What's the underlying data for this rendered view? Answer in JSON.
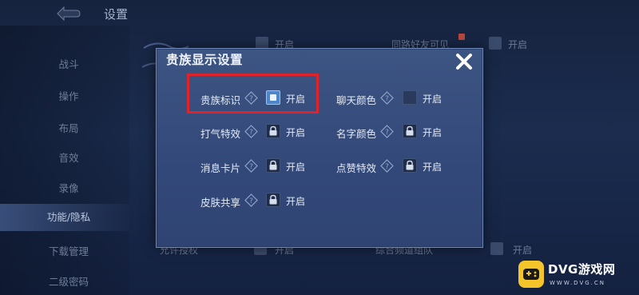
{
  "background": {
    "title": "设置",
    "sidebar": [
      "战斗",
      "操作",
      "布局",
      "音效",
      "录像",
      "功能/隐私",
      "下载管理",
      "二级密码"
    ],
    "active_sidebar": "功能/隐私",
    "partial_texts": {
      "top_left_option": "开启",
      "top_mid_option": "同路好友可见",
      "top_right_option": "开启",
      "bottom_left_option": "允许授权",
      "bottom_left_state": "开启",
      "bottom_mid_option": "综合频道组队",
      "bottom_right_state": "开启"
    }
  },
  "dialog": {
    "title": "贵族显示设置",
    "options": [
      {
        "label": "贵族标识",
        "state": "开启",
        "control": "checked"
      },
      {
        "label": "聊天颜色",
        "state": "开启",
        "control": "unchecked"
      },
      {
        "label": "打气特效",
        "state": "开启",
        "control": "locked"
      },
      {
        "label": "名字颜色",
        "state": "开启",
        "control": "locked"
      },
      {
        "label": "消息卡片",
        "state": "开启",
        "control": "locked"
      },
      {
        "label": "点赞特效",
        "state": "开启",
        "control": "locked"
      },
      {
        "label": "皮肤共享",
        "state": "开启",
        "control": "locked"
      }
    ]
  },
  "watermark": {
    "brand": "DVG游戏网",
    "url": "WWW.DVG.CN"
  },
  "colors": {
    "dialog_bg": "#3d5583",
    "highlight": "#e0222a",
    "checkbox_checked": "#4f86c9",
    "watermark_logo": "#f3c52a"
  }
}
